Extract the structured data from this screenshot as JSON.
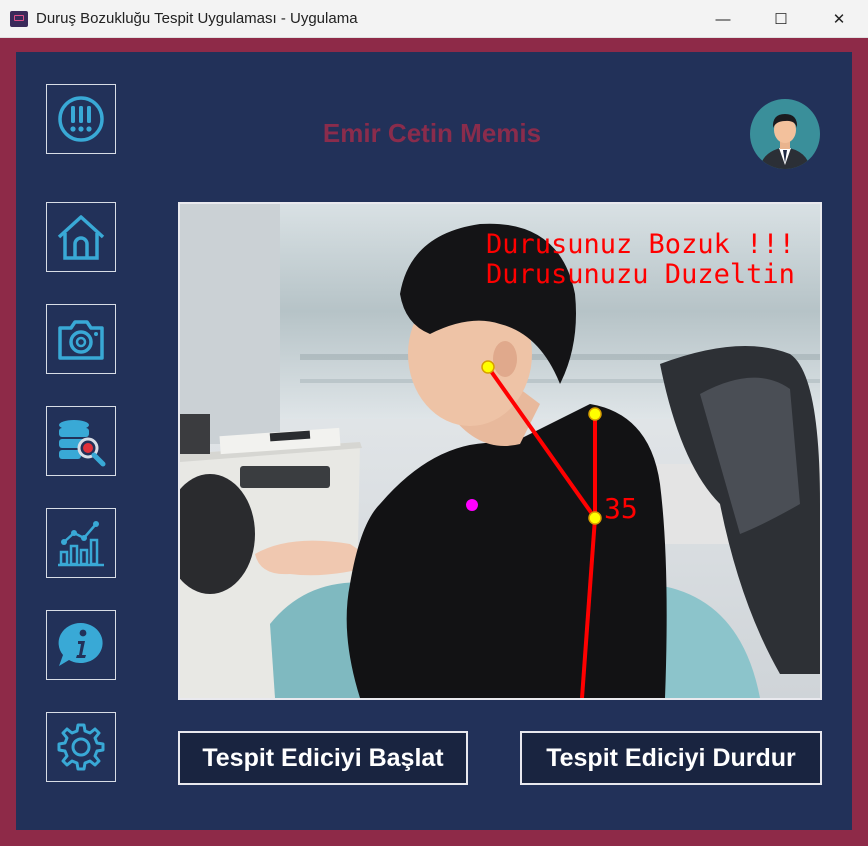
{
  "window": {
    "title": "Duruş Bozukluğu Tespit Uygulaması - Uygulama",
    "minimize_glyph": "—",
    "maximize_glyph": "☐",
    "close_glyph": "✕"
  },
  "colors": {
    "frame": "#8e2a48",
    "panel": "#223159",
    "icon": "#39a9d6",
    "username": "#8a2c4c"
  },
  "sidebar": {
    "items": [
      {
        "name": "alert",
        "icon": "exclamation-icon"
      },
      {
        "name": "home",
        "icon": "home-icon"
      },
      {
        "name": "camera",
        "icon": "camera-icon"
      },
      {
        "name": "database-search",
        "icon": "database-search-icon"
      },
      {
        "name": "statistics",
        "icon": "chart-icon"
      },
      {
        "name": "info",
        "icon": "info-icon"
      },
      {
        "name": "settings",
        "icon": "gear-icon"
      }
    ]
  },
  "header": {
    "user_name": "Emir Cetin Memis",
    "avatar_icon": "user-avatar-icon"
  },
  "camera": {
    "warning_line1": "Durusunuz Bozuk !!!",
    "warning_line2": "Durusunuzu Duzeltin",
    "angle_value": "35"
  },
  "actions": {
    "start_label": "Tespit Ediciyi Başlat",
    "stop_label": "Tespit Ediciyi Durdur"
  }
}
